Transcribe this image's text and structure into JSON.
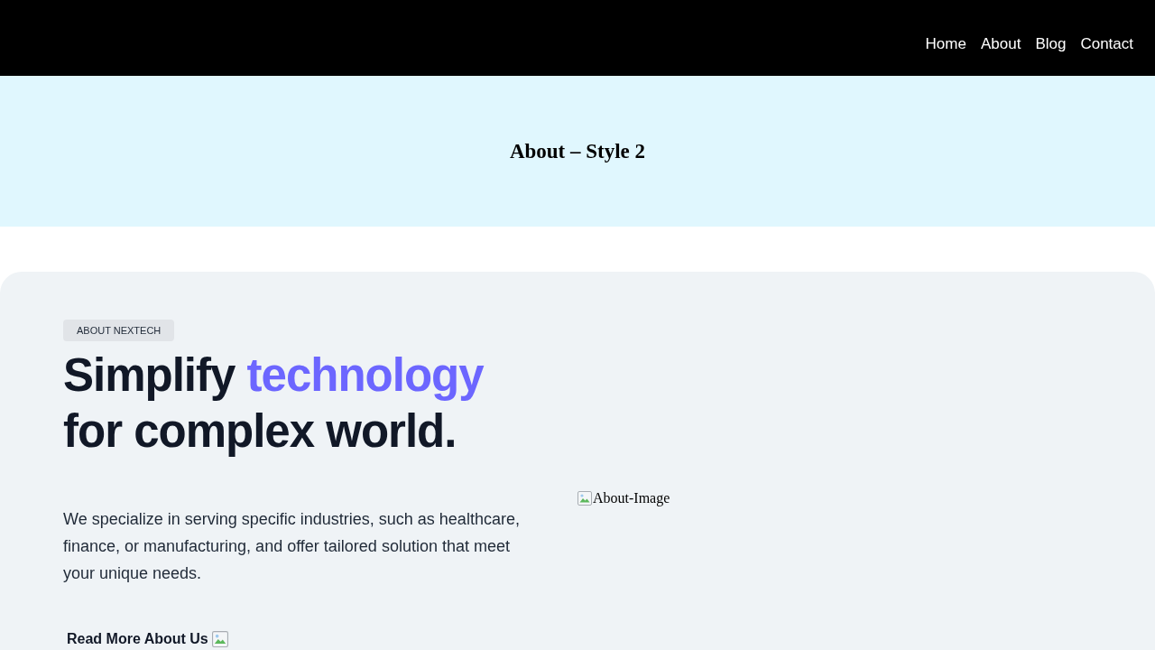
{
  "nav": {
    "items": [
      {
        "label": "Home"
      },
      {
        "label": "About"
      },
      {
        "label": "Blog"
      },
      {
        "label": "Contact"
      }
    ]
  },
  "page_header": {
    "title": "About – Style 2"
  },
  "about": {
    "badge": "ABOUT NEXTECH",
    "heading": [
      {
        "text": "Simplify",
        "accent": false
      },
      {
        "text": "technology",
        "accent": true
      },
      {
        "text": "for complex world.",
        "accent": false
      }
    ],
    "description": "We specialize in serving specific industries, such as healthcare, finance, or manufacturing, and offer tailored solution that meet your unique needs.",
    "image": {
      "alt": "About-Image"
    },
    "link": {
      "label": "Read More About Us"
    }
  }
}
